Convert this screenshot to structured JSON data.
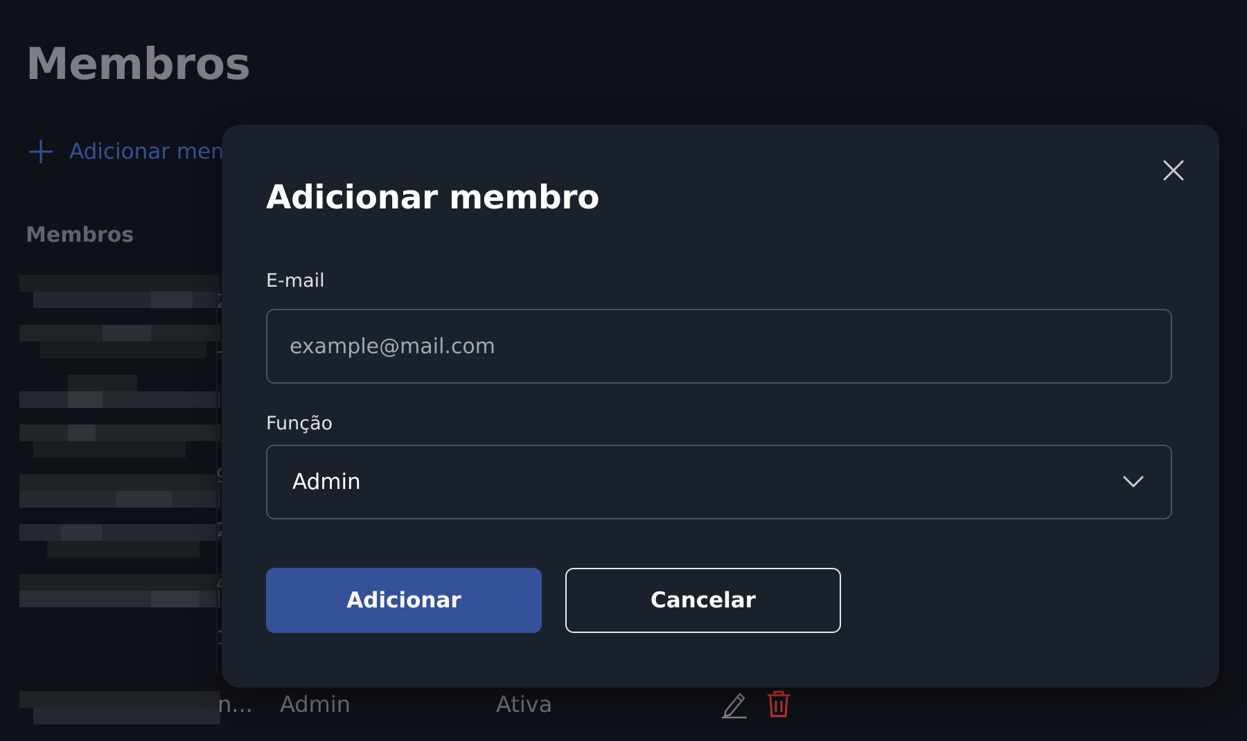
{
  "page": {
    "title": "Membros",
    "add_member_link": "Adicionar membro",
    "members_heading": "Membros",
    "row_fragments": [
      "2",
      "-",
      "",
      "9",
      "2",
      "4",
      "1"
    ],
    "last_row": {
      "name_fragment": "n...",
      "role": "Admin",
      "status": "Ativa"
    }
  },
  "modal": {
    "title": "Adicionar membro",
    "email": {
      "label": "E-mail",
      "placeholder": "example@mail.com",
      "value": ""
    },
    "role": {
      "label": "Função",
      "selected": "Admin"
    },
    "buttons": {
      "submit": "Adicionar",
      "cancel": "Cancelar"
    }
  },
  "icons": {
    "add": "plus-icon",
    "close": "close-icon",
    "dropdown": "chevron-down-icon",
    "edit": "pencil-icon",
    "delete": "trash-icon"
  },
  "colors": {
    "background": "#0e1117",
    "modal": "#1b212b",
    "primary": "#33529a",
    "delete": "#c0332e"
  }
}
